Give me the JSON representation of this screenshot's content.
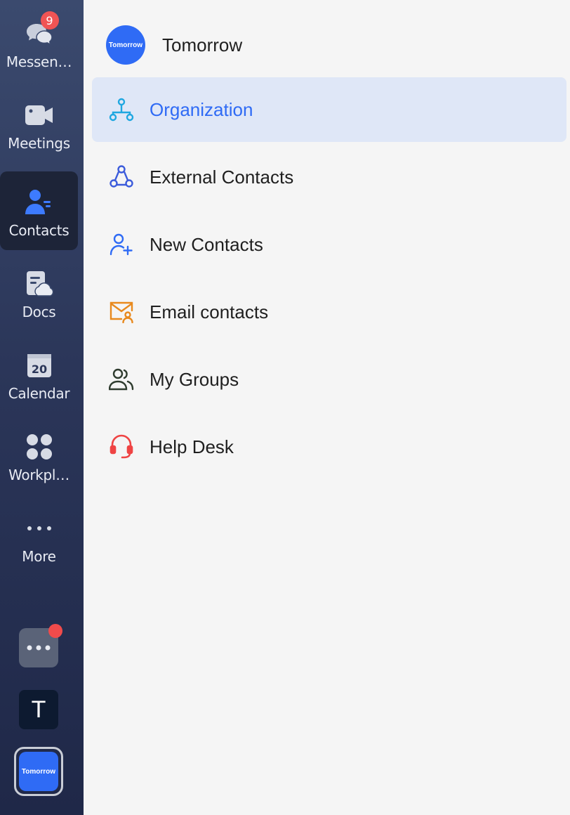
{
  "sidebar": {
    "nav": [
      {
        "label": "Messen…",
        "icon": "chat-bubbles-icon",
        "badge": "9"
      },
      {
        "label": "Meetings",
        "icon": "video-camera-icon"
      },
      {
        "label": "Contacts",
        "icon": "contacts-icon",
        "active": true
      },
      {
        "label": "Docs",
        "icon": "docs-cloud-icon"
      },
      {
        "label": "Calendar",
        "icon": "calendar-icon",
        "day": "20"
      },
      {
        "label": "Workpl…",
        "icon": "workplace-grid-icon"
      },
      {
        "label": "More",
        "icon": "more-dots-icon"
      }
    ],
    "tenants": [
      {
        "label": "T"
      },
      {
        "label": "Tomorrow"
      }
    ]
  },
  "main": {
    "org": {
      "avatar_text": "Tomorrow",
      "name": "Tomorrow"
    },
    "menu": [
      {
        "label": "Organization",
        "icon": "organization-tree-icon",
        "active": true,
        "color": "#2f6bf5"
      },
      {
        "label": "External Contacts",
        "icon": "external-contacts-icon",
        "color": "#3b5bdb"
      },
      {
        "label": "New Contacts",
        "icon": "add-contact-icon",
        "color": "#2f6bf5"
      },
      {
        "label": "Email contacts",
        "icon": "email-contact-icon",
        "color": "#e8891d"
      },
      {
        "label": "My Groups",
        "icon": "groups-icon",
        "color": "#2e3b2e"
      },
      {
        "label": "Help Desk",
        "icon": "headset-icon",
        "color": "#ef4444"
      }
    ]
  }
}
